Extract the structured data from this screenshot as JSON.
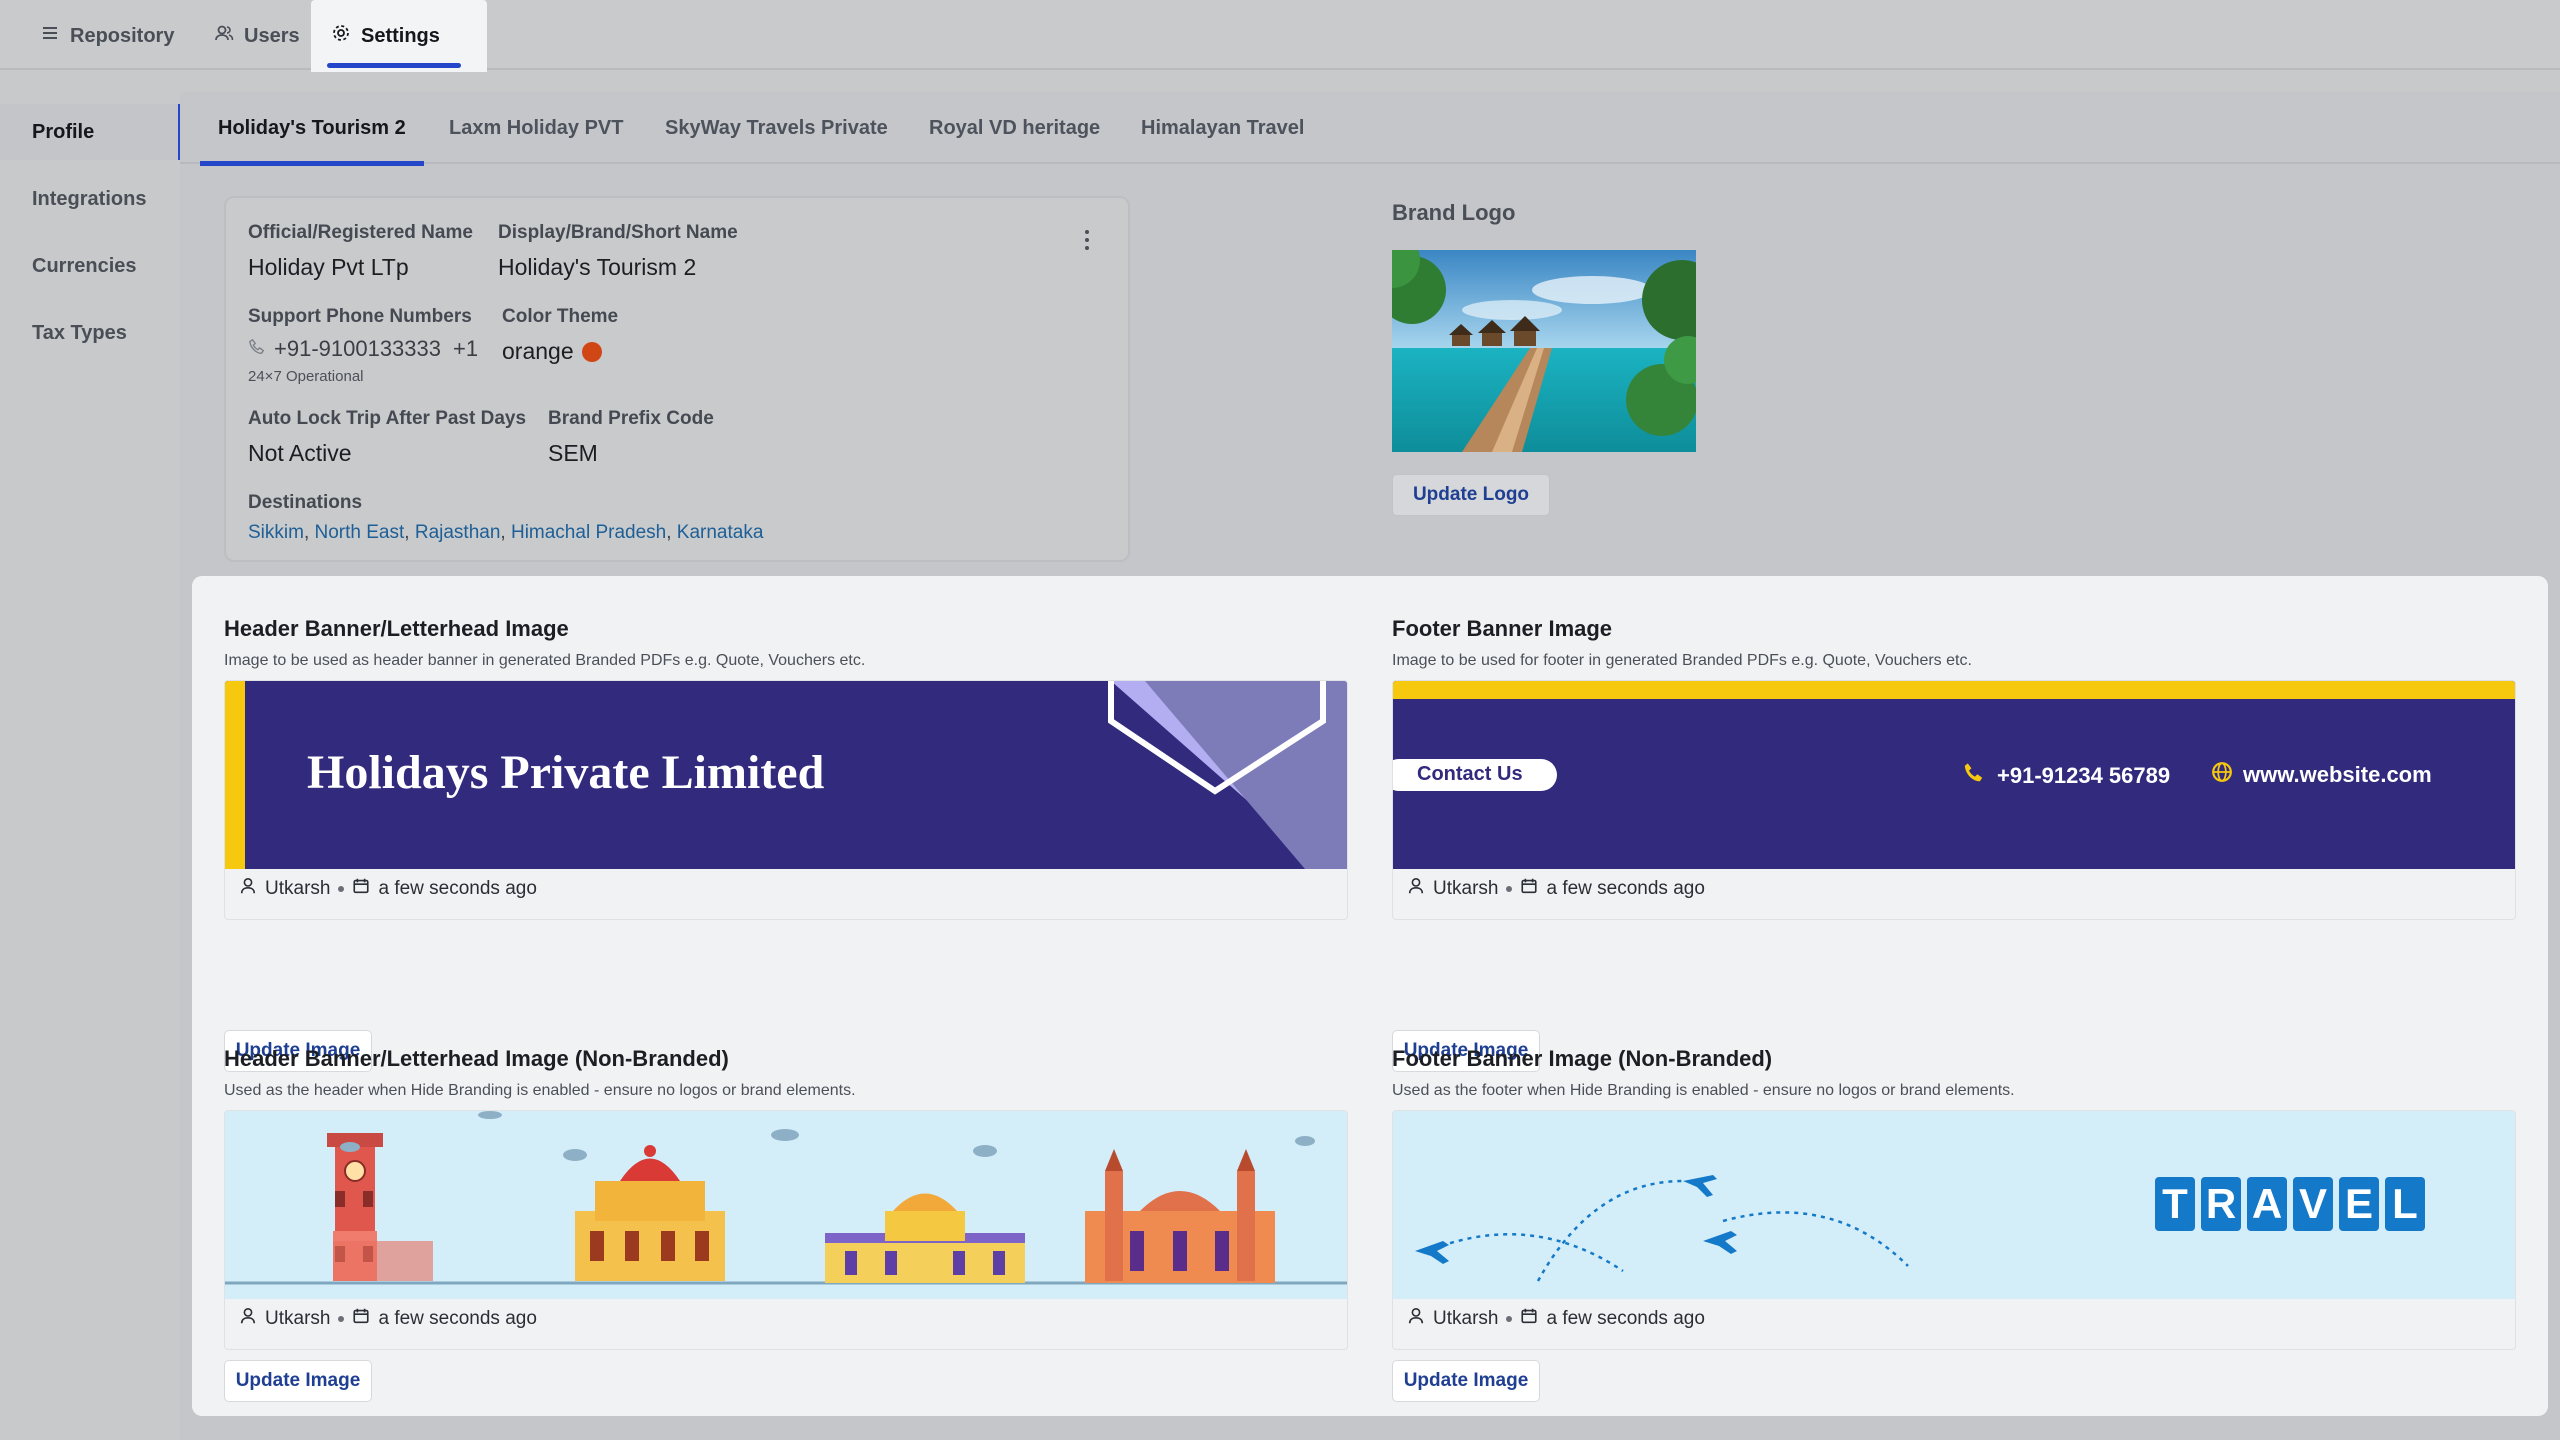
{
  "topnav": {
    "tabs": [
      {
        "label": "Repository",
        "icon": "list-icon"
      },
      {
        "label": "Users",
        "icon": "users-icon"
      },
      {
        "label": "Settings",
        "icon": "gear-icon"
      }
    ],
    "active": "Settings"
  },
  "sidebar": {
    "items": [
      {
        "label": "Profile"
      },
      {
        "label": "Integrations"
      },
      {
        "label": "Currencies"
      },
      {
        "label": "Tax Types"
      }
    ],
    "active": "Profile"
  },
  "brand_tabs": {
    "items": [
      {
        "label": "Holiday's Tourism 2"
      },
      {
        "label": "Laxm Holiday PVT"
      },
      {
        "label": "SkyWay Travels Private"
      },
      {
        "label": "Royal VD heritage"
      },
      {
        "label": "Himalayan Travel"
      }
    ],
    "active": "Holiday's Tourism 2"
  },
  "profile": {
    "official_name_label": "Official/Registered Name",
    "official_name": "Holiday Pvt LTp",
    "display_name_label": "Display/Brand/Short Name",
    "display_name": "Holiday's Tourism 2",
    "phone_label": "Support Phone Numbers",
    "phone": "+91-9100133333",
    "phone_more": "+1",
    "phone_note": "24×7 Operational",
    "color_label": "Color Theme",
    "color_value": "orange",
    "color_hex": "#d04614",
    "autolock_label": "Auto Lock Trip After Past Days",
    "autolock_value": "Not Active",
    "prefix_label": "Brand Prefix Code",
    "prefix_value": "SEM",
    "destinations_label": "Destinations",
    "destinations": [
      "Sikkim",
      "North East",
      "Rajasthan",
      "Himachal Pradesh",
      "Karnataka"
    ]
  },
  "brand_logo": {
    "title": "Brand Logo",
    "button": "Update Logo"
  },
  "banners": {
    "header": {
      "title": "Header Banner/Letterhead Image",
      "desc": "Image to be used as header banner in generated Branded PDFs e.g. Quote, Vouchers etc.",
      "image_text": "Holidays Private Limited",
      "user": "Utkarsh",
      "time": "a few seconds ago",
      "button": "Update Image"
    },
    "footer": {
      "title": "Footer Banner Image",
      "desc": "Image to be used for footer in generated Branded PDFs e.g. Quote, Vouchers etc.",
      "image_contact": "Contact Us",
      "image_phone": "+91-91234 56789",
      "image_web": "www.website.com",
      "user": "Utkarsh",
      "time": "a few seconds ago",
      "button": "Update Image"
    },
    "header_nb": {
      "title": "Header Banner/Letterhead Image (Non-Branded)",
      "desc": "Used as the header when Hide Branding is enabled - ensure no logos or brand elements.",
      "user": "Utkarsh",
      "time": "a few seconds ago",
      "button": "Update Image"
    },
    "footer_nb": {
      "title": "Footer Banner Image (Non-Branded)",
      "desc": "Used as the footer when Hide Branding is enabled - ensure no logos or brand elements.",
      "image_word": [
        "T",
        "R",
        "A",
        "V",
        "E",
        "L"
      ],
      "user": "Utkarsh",
      "time": "a few seconds ago",
      "button": "Update Image"
    }
  },
  "colors": {
    "accent": "#2446c9",
    "banner_navy": "#312a7d",
    "banner_yellow": "#f6c90e",
    "travel_blue": "#1479c9",
    "sky": "#d3eef9"
  }
}
